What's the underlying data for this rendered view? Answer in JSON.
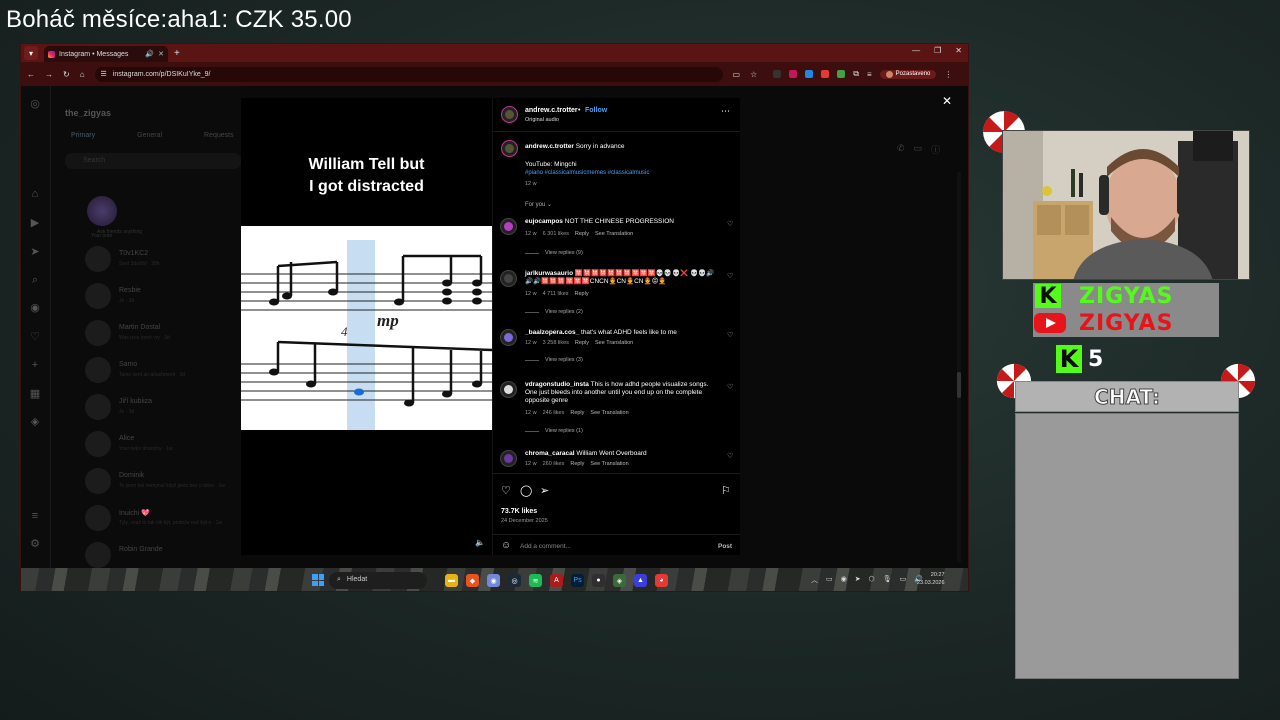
{
  "stream": {
    "banner": "Boháč měsíce:aha1: CZK 35.00"
  },
  "browser": {
    "tab_title": "Instagram • Messages",
    "new_tab": "+",
    "url": "instagram.com/p/DSIKuIYke_9/",
    "profile_label": "Pozastaveno"
  },
  "inbox": {
    "username": "the_zigyas",
    "tabs": [
      "Primary",
      "General",
      "Requests"
    ],
    "search_placeholder": "Search",
    "note_label": "Ask friends anything",
    "note_name": "Your note",
    "conversations": [
      {
        "name": "T0v1KC2",
        "sub": "Sent 3dsdfsf · 28h"
      },
      {
        "name": "Resbie",
        "sub": "Jo · 3d"
      },
      {
        "name": "Martin Dostal",
        "sub": "Was jsou tomé vry · 3d"
      },
      {
        "name": "Samo",
        "sub": "Tamo sent an attachment · 3d"
      },
      {
        "name": "Jiří kubiiza",
        "sub": "Jo · 3d"
      },
      {
        "name": "Alice",
        "sub": "Your nejrv shandny · 1w"
      },
      {
        "name": "Dominik",
        "sub": "To jsem tak nemynal když jsem bez o tatce · 1w"
      },
      {
        "name": "Inuichi 💖",
        "sub": "Tyly, snaž to tak nik kýt, protože než být n · 1w"
      },
      {
        "name": "Robin Grande",
        "sub": ""
      }
    ]
  },
  "reel": {
    "caption_line1": "William Tell but",
    "caption_line2": "I got distracted",
    "score_measure": "4",
    "score_dynamic": "mp"
  },
  "post": {
    "author": "andrew.c.trotter",
    "dot": "•",
    "follow": "Follow",
    "audio": "Original audio",
    "caption_user": "andrew.c.trotter",
    "caption_text": "Sorry in advance",
    "caption_yt": "YouTube: Mingchi",
    "caption_tags": "#piano #classicalmusicmemes #classicalmusic",
    "caption_time": "12 w",
    "for_you": "For you",
    "likes": "73.7K likes",
    "date": "24 December 2025",
    "add_comment": "Add a comment...",
    "post_label": "Post"
  },
  "comments": [
    {
      "user": "eujocampos",
      "text": "NOT THE CHINESE PROGRESSION",
      "time": "12 w",
      "likes": "6 301 likes",
      "reply": "Reply",
      "translate": "See Translation",
      "replies": "View replies (9)",
      "color": "#b93cc4"
    },
    {
      "user": "jarlkurwasaurio",
      "text": "🈲🈲🈲🈲🈲🈲🈲🈲🈲🈲💀💀💀❌ 💀💀🔊🔊🔊🈲🈲🈲🈲🈲🈲CNCN👲CN👲CN👲😡👲",
      "time": "12 w",
      "likes": "4 711 likes",
      "reply": "Reply",
      "translate": "",
      "replies": "View replies (2)",
      "color": "#222222"
    },
    {
      "user": "_baalzopera.cos_",
      "text": "that's what ADHD feels like to me",
      "time": "12 w",
      "likes": "3 258 likes",
      "reply": "Reply",
      "translate": "See Translation",
      "replies": "View replies (3)",
      "color": "#7a6ad4"
    },
    {
      "user": "vdragonstudio_insta",
      "text": "This is how adhd people visualize songs. One just bleeds into another until you end up on the complete opposite genre",
      "time": "12 w",
      "likes": "246 likes",
      "reply": "Reply",
      "translate": "See Translation",
      "replies": "View replies (1)",
      "color": "#eeeeee"
    },
    {
      "user": "chroma_caracal",
      "text": "William Went Overboard",
      "time": "12 w",
      "likes": "260 likes",
      "reply": "Reply",
      "translate": "See Translation",
      "replies": "",
      "color": "#6a3aa4"
    }
  ],
  "taskbar": {
    "search_label": "Hledat",
    "time": "20:27",
    "date": "23.03.2026"
  },
  "overlay": {
    "kick_name": "ZIGYAS",
    "youtube_name": "ZIGYAS",
    "kick_letter": "K",
    "kick_count": "5",
    "chat_label": "CHAT:",
    "kick_color": "#53fc18",
    "youtube_color": "#e8141c"
  }
}
